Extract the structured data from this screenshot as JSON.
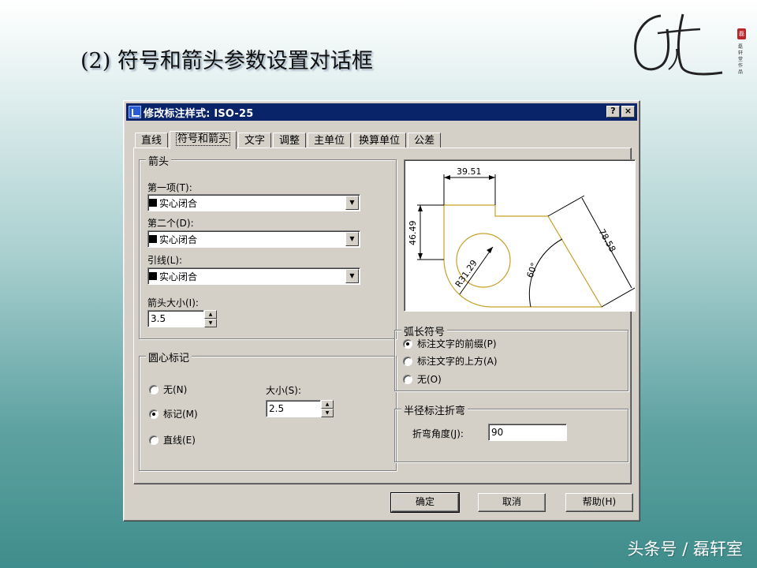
{
  "slide": {
    "title": "(2) 符号和箭头参数设置对话框",
    "footer": "头条号 / 磊轩室",
    "seal_text": "磊",
    "side_text": "磊轩堂 作品"
  },
  "dialog": {
    "title": "修改标注样式: ISO-25",
    "help_label": "?",
    "close_label": "×",
    "tabs": [
      {
        "label": "直线"
      },
      {
        "label": "符号和箭头"
      },
      {
        "label": "文字"
      },
      {
        "label": "调整"
      },
      {
        "label": "主单位"
      },
      {
        "label": "换算单位"
      },
      {
        "label": "公差"
      }
    ],
    "arrows": {
      "group_label": "箭头",
      "first_label": "第一项(T):",
      "first_value": "实心闭合",
      "second_label": "第二个(D):",
      "second_value": "实心闭合",
      "leader_label": "引线(L):",
      "leader_value": "实心闭合",
      "size_label": "箭头大小(I):",
      "size_value": "3.5"
    },
    "center_marks": {
      "group_label": "圆心标记",
      "options": [
        "无(N)",
        "标记(M)",
        "直线(E)"
      ],
      "selected": "标记(M)",
      "size_label": "大小(S):",
      "size_value": "2.5"
    },
    "arc_length": {
      "group_label": "弧长符号",
      "options": [
        "标注文字的前缀(P)",
        "标注文字的上方(A)",
        "无(O)"
      ],
      "selected": "标注文字的前缀(P)"
    },
    "radius_jog": {
      "group_label": "半径标注折弯",
      "angle_label": "折弯角度(J):",
      "angle_value": "90"
    },
    "preview": {
      "dim_top": "39.51",
      "dim_left": "46.49",
      "dim_right": "78.58",
      "dim_radius": "R31.29",
      "dim_angle": "60°"
    },
    "buttons": {
      "ok": "确定",
      "cancel": "取消",
      "help": "帮助(H)"
    }
  }
}
